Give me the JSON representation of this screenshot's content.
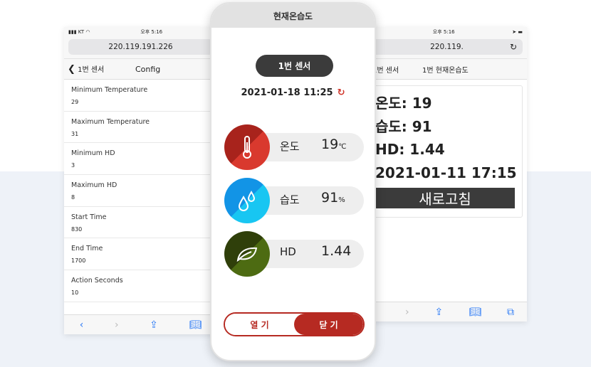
{
  "left": {
    "carrier": "KT",
    "time": "오후 5:16",
    "url": "220.119.191.226",
    "back_label": "1번 센서",
    "title": "Config",
    "items": [
      {
        "label": "Minimum Temperature",
        "value": "29"
      },
      {
        "label": "Maximum Temperature",
        "value": "31"
      },
      {
        "label": "Minimum HD",
        "value": "3"
      },
      {
        "label": "Maximum HD",
        "value": "8"
      },
      {
        "label": "Start Time",
        "value": "830"
      },
      {
        "label": "End Time",
        "value": "1700"
      },
      {
        "label": "Action Seconds",
        "value": "10"
      }
    ]
  },
  "right": {
    "time": "오후 5:16",
    "url": "220.119.",
    "tab1": "1번 센서",
    "tab2": "1번 현재온습도",
    "lines": [
      "온도: 19",
      "습도: 91",
      "HD: 1.44",
      "2021-01-11 17:15"
    ],
    "refresh": "새로고침"
  },
  "center": {
    "title": "현재온습도",
    "sensor": "1번 센서",
    "datetime": "2021-01-18 11:25",
    "readings": [
      {
        "label": "온도",
        "value": "19",
        "unit": "℃",
        "icon": "thermometer-icon",
        "colors": [
          "#a8231c",
          "#d9392e"
        ]
      },
      {
        "label": "습도",
        "value": "91",
        "unit": "%",
        "icon": "water-drops-icon",
        "colors": [
          "#1294e6",
          "#18c6f2"
        ]
      },
      {
        "label": "HD",
        "value": "1.44",
        "unit": "",
        "icon": "leaf-icon",
        "colors": [
          "#2f3f0a",
          "#4d6b12"
        ]
      }
    ],
    "open": "열 기",
    "close": "닫 기"
  }
}
